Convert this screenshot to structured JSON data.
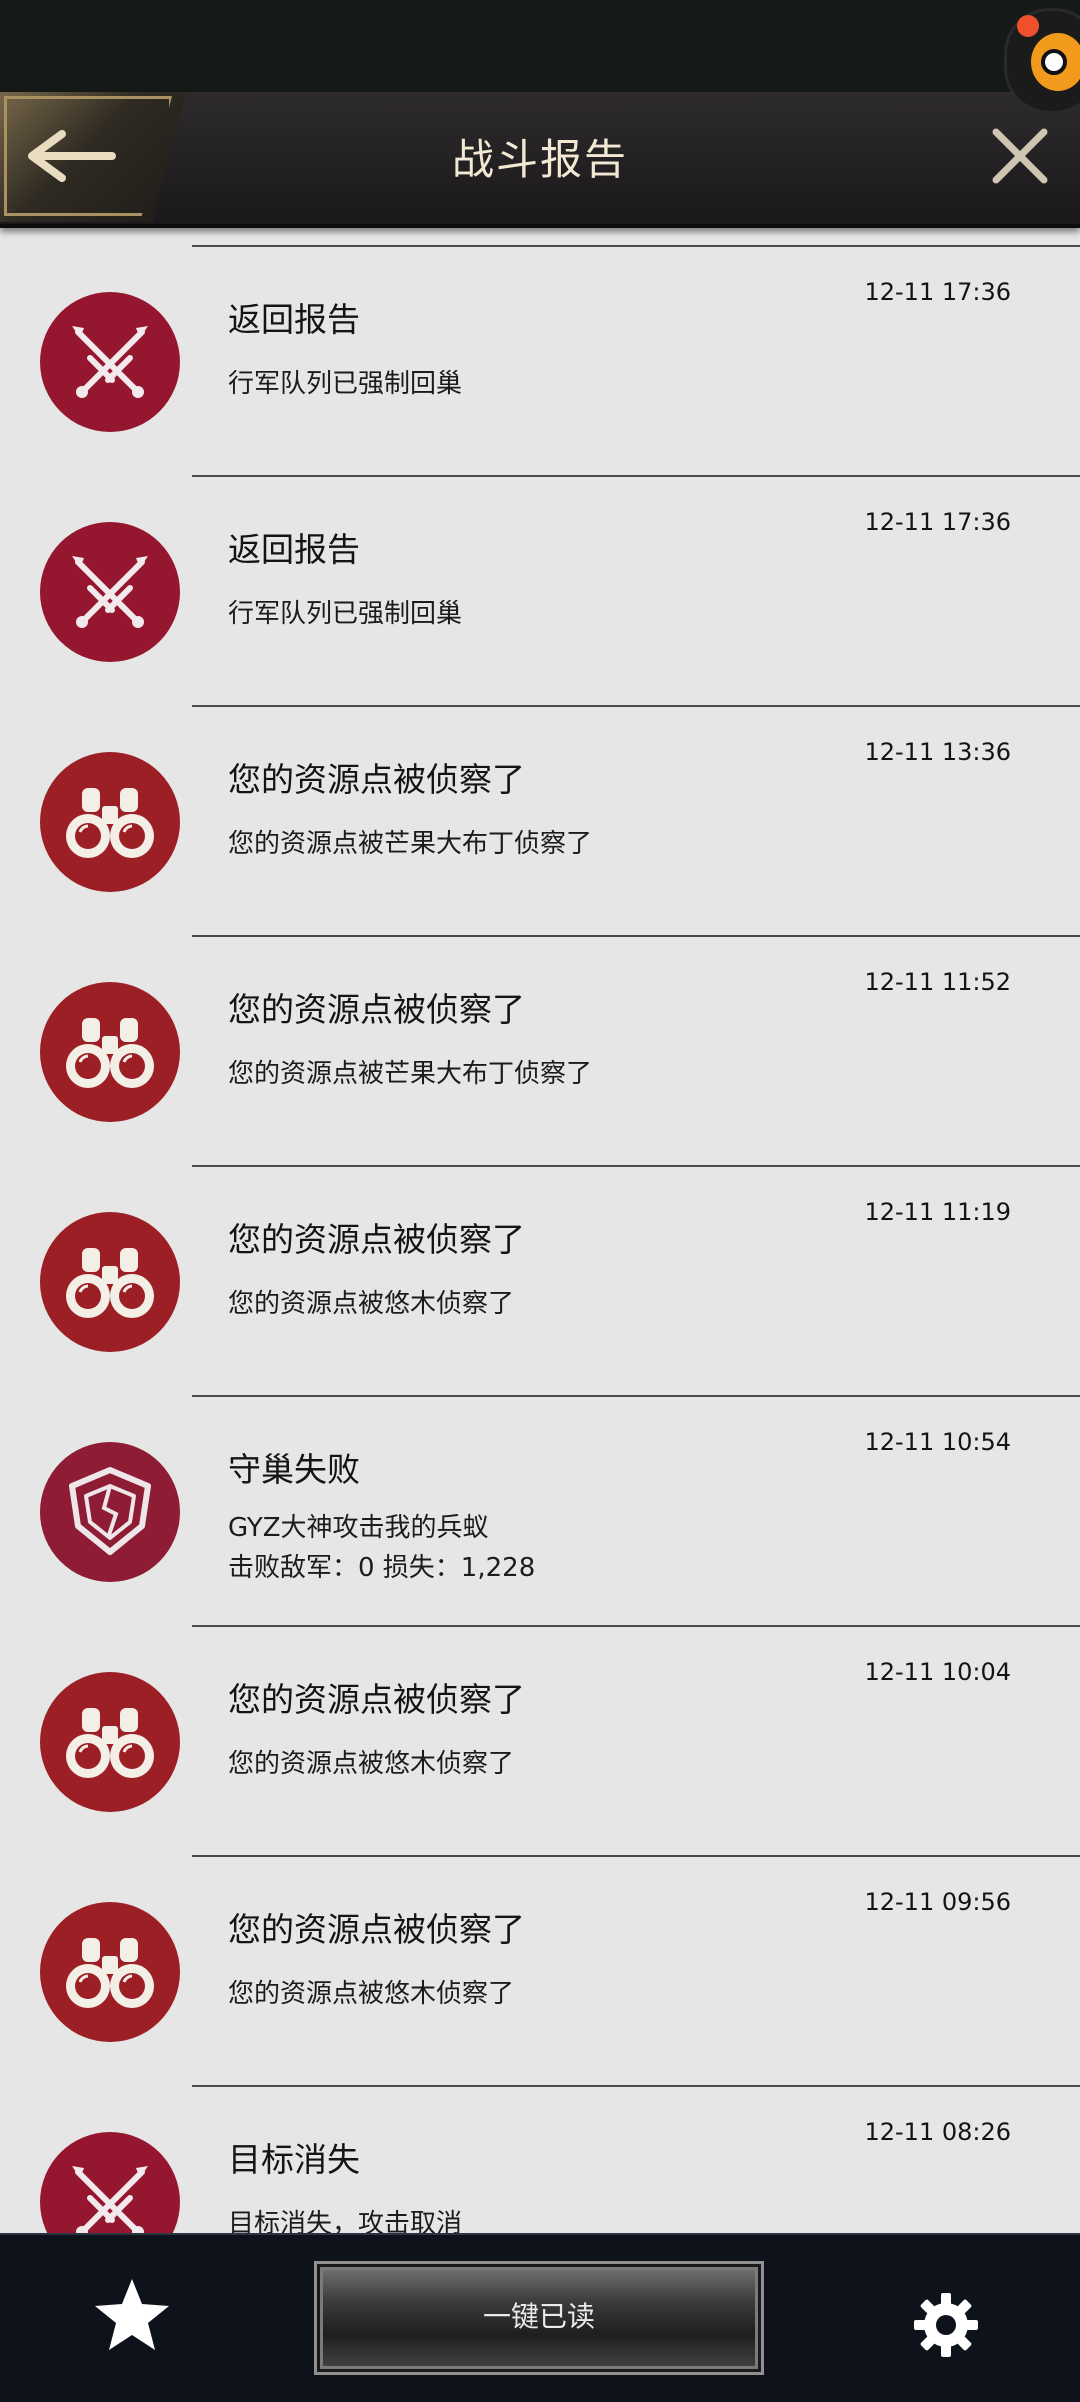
{
  "header": {
    "title": "战斗报告",
    "back_icon": "arrow-left-icon",
    "close_icon": "close-icon"
  },
  "reports": [
    {
      "icon": "crossed-swords-icon",
      "title": "返回报告",
      "body": [
        "行军队列已强制回巢"
      ],
      "time": "12-11 17:36"
    },
    {
      "icon": "crossed-swords-icon",
      "title": "返回报告",
      "body": [
        "行军队列已强制回巢"
      ],
      "time": "12-11 17:36"
    },
    {
      "icon": "binoculars-icon",
      "title": "您的资源点被侦察了",
      "body": [
        "您的资源点被芒果大布丁侦察了"
      ],
      "time": "12-11 13:36"
    },
    {
      "icon": "binoculars-icon",
      "title": "您的资源点被侦察了",
      "body": [
        "您的资源点被芒果大布丁侦察了"
      ],
      "time": "12-11 11:52"
    },
    {
      "icon": "binoculars-icon",
      "title": "您的资源点被侦察了",
      "body": [
        "您的资源点被悠木侦察了"
      ],
      "time": "12-11 11:19"
    },
    {
      "icon": "broken-shield-icon",
      "title": "守巢失败",
      "body": [
        "GYZ大神攻击我的兵蚁",
        "击败敌军：0 损失：1,228"
      ],
      "time": "12-11 10:54"
    },
    {
      "icon": "binoculars-icon",
      "title": "您的资源点被侦察了",
      "body": [
        "您的资源点被悠木侦察了"
      ],
      "time": "12-11 10:04"
    },
    {
      "icon": "binoculars-icon",
      "title": "您的资源点被侦察了",
      "body": [
        "您的资源点被悠木侦察了"
      ],
      "time": "12-11 09:56"
    },
    {
      "icon": "crossed-swords-icon",
      "title": "目标消失",
      "body": [
        "目标消失，攻击取消"
      ],
      "time": "12-11 08:26"
    }
  ],
  "footer": {
    "favorites_icon": "star-icon",
    "mark_all_read_label": "一键已读",
    "settings_icon": "gear-icon"
  },
  "colors": {
    "list_background": "#e6e6e6",
    "battle_icon_bg": "#95172f",
    "scout_icon_bg": "#9b1f24",
    "header_title": "#f3e8d4"
  }
}
